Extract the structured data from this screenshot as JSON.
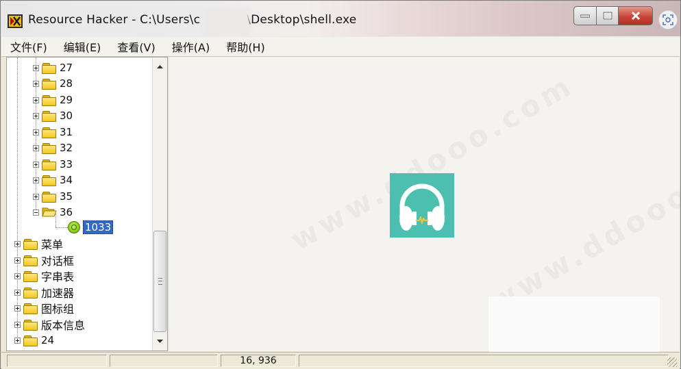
{
  "window": {
    "title_prefix": "Resource Hacker  -  C:\\Users\\c",
    "title_suffix": "\\Desktop\\shell.exe"
  },
  "menu": {
    "items": [
      "文件(F)",
      "编辑(E)",
      "查看(V)",
      "操作(A)",
      "帮助(H)"
    ]
  },
  "tree": {
    "numbered_folders": [
      "27",
      "28",
      "29",
      "30",
      "31",
      "32",
      "33",
      "34",
      "35"
    ],
    "expanded_folder": "36",
    "child_resource": "1033",
    "root_items": [
      "菜单",
      "对话框",
      "字串表",
      "加速器",
      "图标组",
      "版本信息",
      "24"
    ]
  },
  "statusbar": {
    "offset_text": "16, 936"
  },
  "preview": {
    "icon": "headphones-icon",
    "background_color": "#4cbfb0"
  },
  "colors": {
    "selection": "#3169c6",
    "folder": "#f4c81a"
  }
}
